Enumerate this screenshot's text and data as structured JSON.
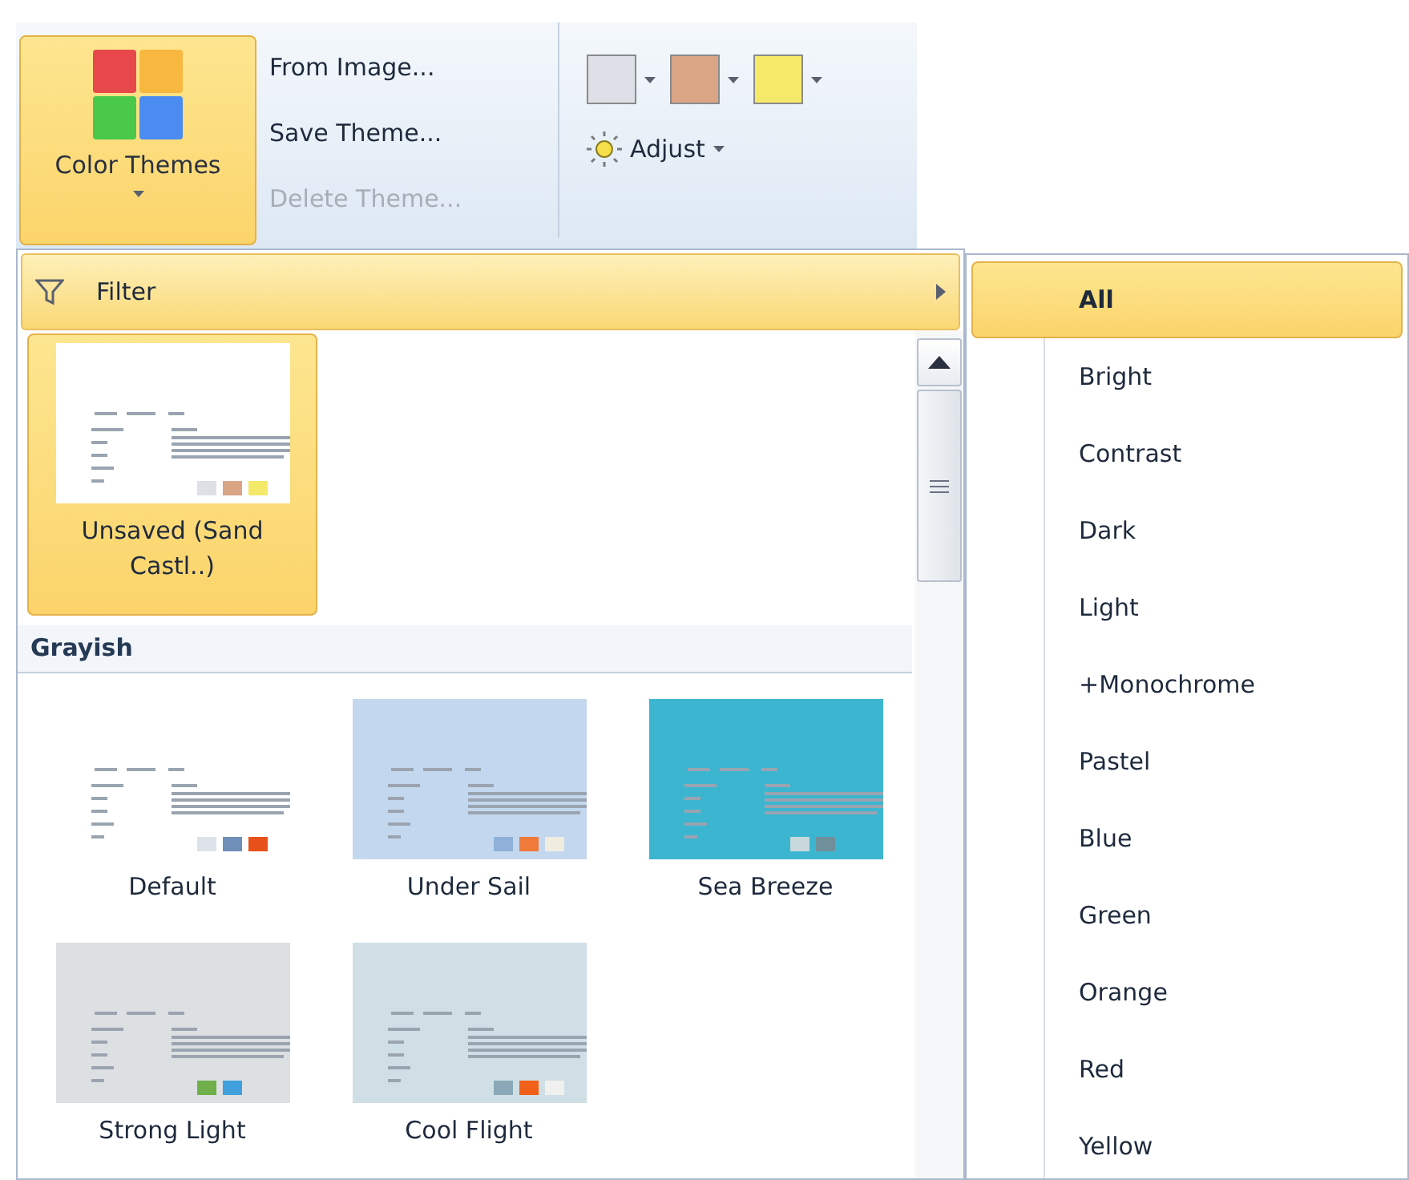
{
  "ribbon": {
    "color_themes_button": {
      "label": "Color Themes",
      "expanded": true
    },
    "commands": [
      {
        "label": "From Image...",
        "disabled": false
      },
      {
        "label": "Save Theme...",
        "disabled": false
      },
      {
        "label": "Delete Theme...",
        "disabled": true
      }
    ],
    "color_buttons": [
      {
        "color": "#dde0e6"
      },
      {
        "color": "#d9a585"
      },
      {
        "color": "#f5e96a"
      }
    ],
    "adjust_button": {
      "label": "Adjust"
    }
  },
  "gallery": {
    "filter": {
      "label": "Filter",
      "highlighted": true
    },
    "current": {
      "label": "Unsaved (Sand Castl..)",
      "selected": true,
      "color": "#ffffff",
      "swatches": [
        {
          "color": "#dde0e6"
        },
        {
          "color": "#d9a585"
        },
        {
          "color": "#f5e96a"
        }
      ]
    },
    "sections": [
      {
        "title": "Grayish",
        "themes": [
          {
            "label": "Default",
            "selected": false,
            "color": "#ffffff",
            "swatches": [
              {
                "color": "#dde3e8"
              },
              {
                "color": "#6f8fb8"
              },
              {
                "color": "#e8501a"
              }
            ]
          },
          {
            "label": "Under Sail",
            "selected": false,
            "color": "#c3d8ee",
            "swatches": [
              {
                "color": "#8fb0d8"
              },
              {
                "color": "#ef7a3a"
              },
              {
                "color": "#f0ede0"
              }
            ]
          },
          {
            "label": "Sea Breeze",
            "selected": false,
            "color": "#3cb5d0",
            "swatches": [
              {
                "color": "#c8d8dc"
              },
              {
                "color": "#6f8f9a"
              }
            ]
          },
          {
            "label": "Strong Light",
            "selected": false,
            "color": "#dde0e3",
            "swatches": [
              {
                "color": "#6fb04a"
              },
              {
                "color": "#3fa0dc"
              }
            ]
          },
          {
            "label": "Cool Flight",
            "selected": false,
            "color": "#d0dfe6",
            "swatches": [
              {
                "color": "#8aa8b8"
              },
              {
                "color": "#f06018"
              },
              {
                "color": "#f0f0ee"
              }
            ]
          }
        ]
      }
    ]
  },
  "filter_menu": {
    "items": [
      {
        "label": "All",
        "selected": true
      },
      {
        "label": "Bright",
        "selected": false
      },
      {
        "label": "Contrast",
        "selected": false
      },
      {
        "label": "Dark",
        "selected": false
      },
      {
        "label": "Light",
        "selected": false
      },
      {
        "label": "+Monochrome",
        "selected": false
      },
      {
        "label": "Pastel",
        "selected": false
      },
      {
        "label": "Blue",
        "selected": false
      },
      {
        "label": "Green",
        "selected": false
      },
      {
        "label": "Orange",
        "selected": false
      },
      {
        "label": "Red",
        "selected": false
      },
      {
        "label": "Yellow",
        "selected": false
      }
    ]
  }
}
